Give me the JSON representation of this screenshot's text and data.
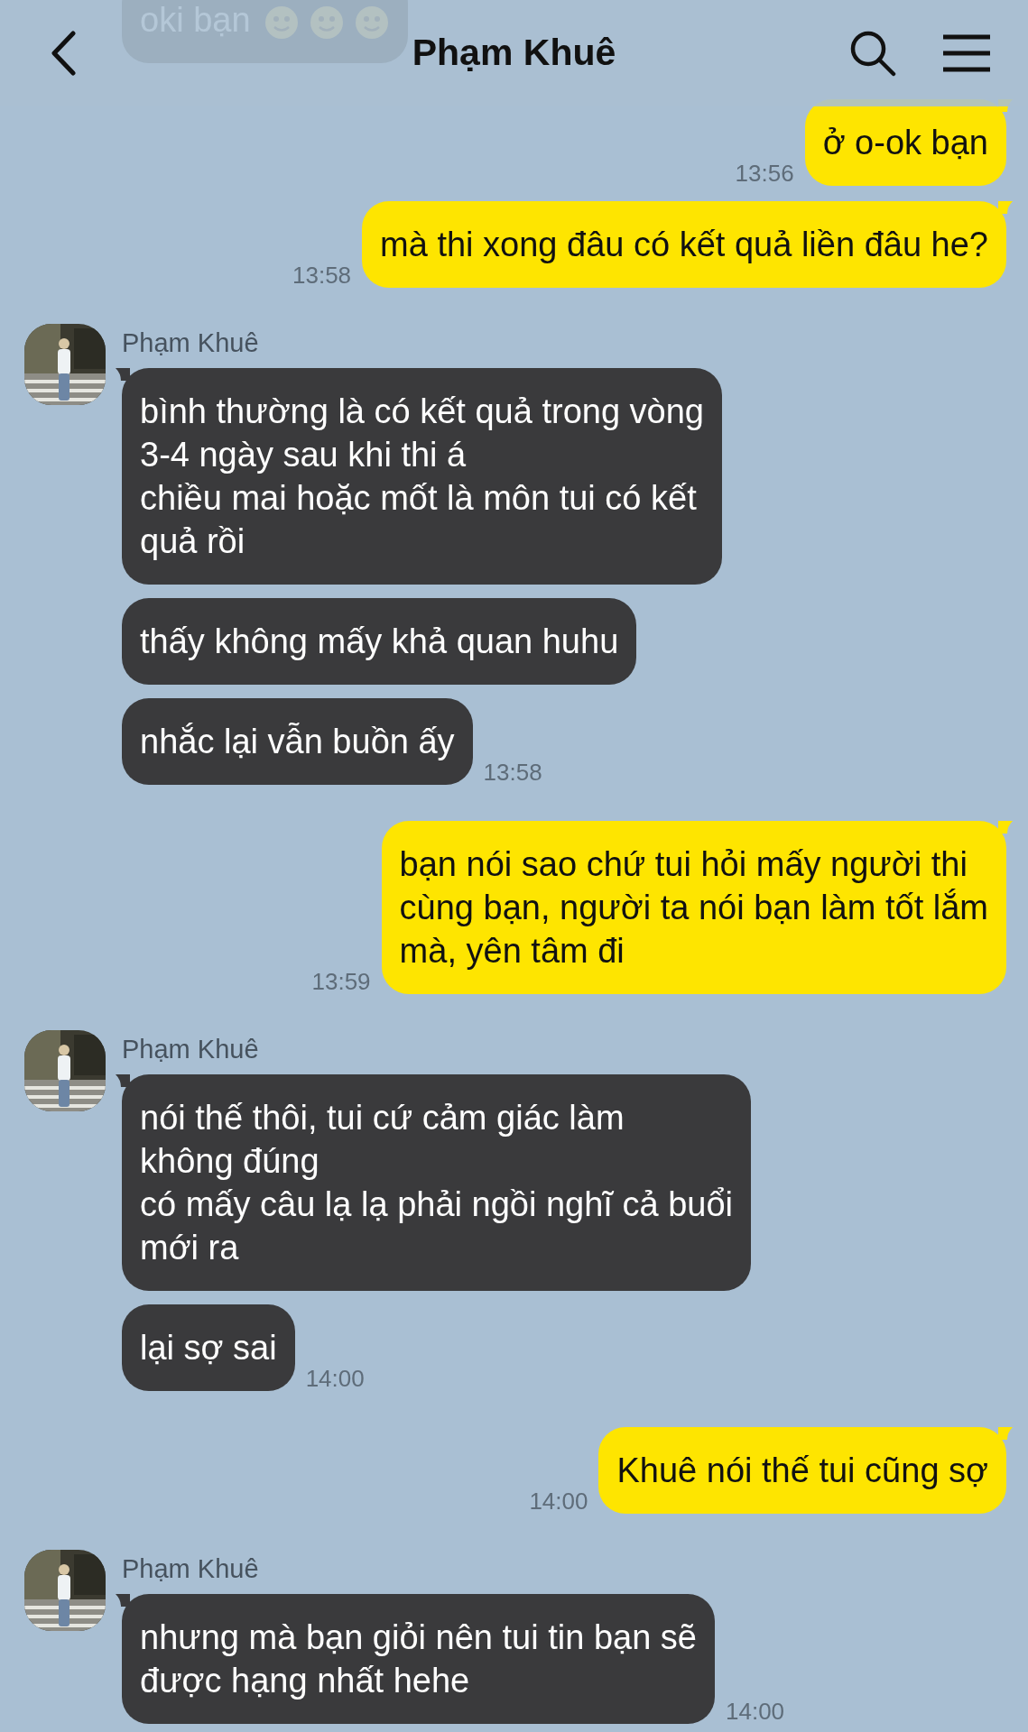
{
  "header": {
    "title": "Phạm Khuê"
  },
  "groups": [
    {
      "kind": "received",
      "bubbles": [
        {
          "text": "oki bạn",
          "has_emojis": true
        }
      ]
    },
    {
      "kind": "sent",
      "bubbles": [
        {
          "text": "ở o-ok bạn",
          "time": "13:56"
        },
        {
          "text": "mà thi xong đâu có kết quả liền đâu he?",
          "time": "13:58"
        }
      ]
    },
    {
      "kind": "received",
      "sender": "Phạm Khuê",
      "bubbles": [
        {
          "text": "bình thường là có kết quả trong vòng\n3-4 ngày sau khi thi á\nchiều mai hoặc mốt là môn tui có kết\nquả rồi"
        },
        {
          "text": "thấy không mấy khả quan huhu"
        },
        {
          "text": "nhắc lại vẫn buồn ấy",
          "time": "13:58"
        }
      ]
    },
    {
      "kind": "sent",
      "bubbles": [
        {
          "text": "bạn nói sao chứ tui hỏi mấy người thi\ncùng bạn, người ta nói bạn làm tốt lắm\nmà, yên tâm đi",
          "time": "13:59"
        }
      ]
    },
    {
      "kind": "received",
      "sender": "Phạm Khuê",
      "bubbles": [
        {
          "text": "nói thế thôi, tui cứ cảm giác làm\nkhông đúng\ncó mấy câu lạ lạ phải ngồi nghĩ cả buổi\nmới ra"
        },
        {
          "text": "lại sợ sai",
          "time": "14:00"
        }
      ]
    },
    {
      "kind": "sent",
      "bubbles": [
        {
          "text": "Khuê nói thế tui cũng sợ",
          "time": "14:00"
        }
      ]
    },
    {
      "kind": "received",
      "sender": "Phạm Khuê",
      "bubbles": [
        {
          "text": "nhưng mà bạn giỏi nên tui tin bạn sẽ\nđược hạng nhất hehe",
          "time": "14:00"
        }
      ]
    }
  ]
}
